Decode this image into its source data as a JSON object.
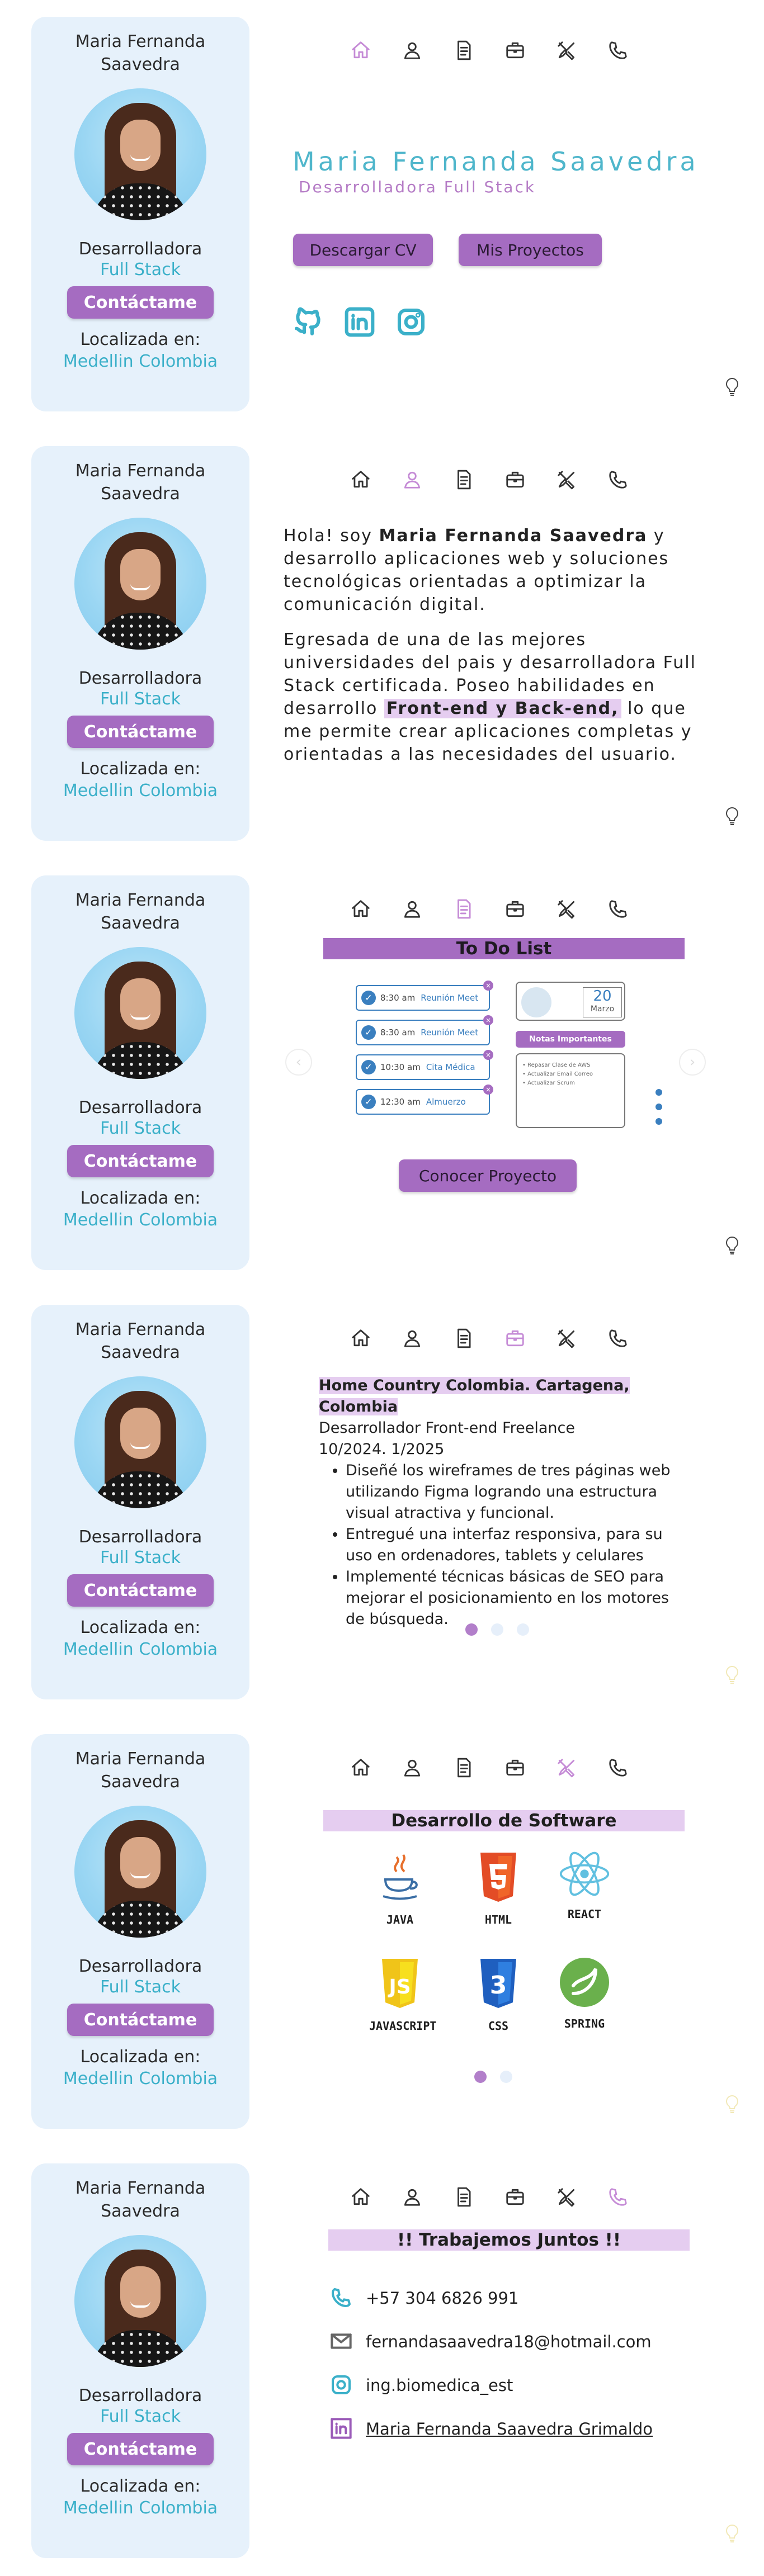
{
  "profile": {
    "name": "Maria Fernanda Saavedra",
    "role": "Desarrolladora",
    "stack": "Full Stack",
    "contact_button": "Contáctame",
    "location_label": "Localizada en:",
    "location": "Medellin Colombia"
  },
  "nav": {
    "items": [
      "home-icon",
      "user-icon",
      "document-icon",
      "briefcase-icon",
      "tools-icon",
      "phone-icon"
    ]
  },
  "hero": {
    "name": "Maria Fernanda Saavedra",
    "role": "Desarrolladora Full Stack",
    "cv_button": "Descargar CV",
    "projects_button": "Mis Proyectos",
    "socials": [
      "github-icon",
      "linkedin-icon",
      "instagram-icon"
    ]
  },
  "about": {
    "p1_a": "Hola! soy ",
    "p1_name": "Maria Fernanda Saavedra",
    "p1_b": " y desarrollo aplicaciones web y soluciones tecnológicas orientadas a optimizar la comunicación digital.",
    "p2_a": "Egresada de una de las mejores universidades del pais y desarrolladora Full Stack certificada. Poseo habilidades en desarrollo ",
    "p2_hl": "Front-end y Back-end,",
    "p2_b": " lo que me permite crear aplicaciones completas y orientadas a las necesidades del usuario."
  },
  "project": {
    "title": "To Do List",
    "tasks": [
      {
        "time": "8:30 am",
        "event": "Reunión Meet"
      },
      {
        "time": "8:30 am",
        "event": "Reunión Meet"
      },
      {
        "time": "10:30 am",
        "event": "Cita Médica"
      },
      {
        "time": "12:30 am",
        "event": "Almuerzo"
      }
    ],
    "calendar_day": "20",
    "calendar_month": "Marzo",
    "notes_label": "Notas Importantes",
    "notes": [
      "Repasar Clase de AWS",
      "Actualizar Email Correo",
      "Actualizar Scrum"
    ],
    "button": "Conocer Proyecto"
  },
  "experience": {
    "company": "Home Country Colombia. Cartagena, Colombia",
    "position": "Desarrollador Front-end  Freelance",
    "dates": "10/2024. 1/2025",
    "bullets": [
      "Diseñé los wireframes de tres páginas web utilizando Figma logrando una estructura visual atractiva y funcional.",
      "Entregué una interfaz responsiva, para su uso en ordenadores, tablets y celulares",
      "Implementé técnicas básicas de SEO para mejorar el posicionamiento en los motores de búsqueda."
    ],
    "dots": 3,
    "active_dot": 1
  },
  "skills": {
    "title": "Desarrollo de Software",
    "items": [
      "JAVA",
      "HTML",
      "REACT",
      "JAVASCRIPT",
      "CSS",
      "SPRING"
    ],
    "dots": 2,
    "active_dot": 1
  },
  "contact": {
    "title": "!! Trabajemos Juntos !!",
    "phone": "+57 304 6826 991",
    "email": "fernandasaavedra18@hotmail.com",
    "instagram": "ing.biomedica_est",
    "linkedin": "Maria Fernanda Saavedra Grimaldo"
  },
  "colors": {
    "accent_purple": "#a56cc1",
    "accent_teal": "#3bb0c9",
    "card_bg": "#e6f1fb",
    "highlight": "#e5cdf0"
  }
}
